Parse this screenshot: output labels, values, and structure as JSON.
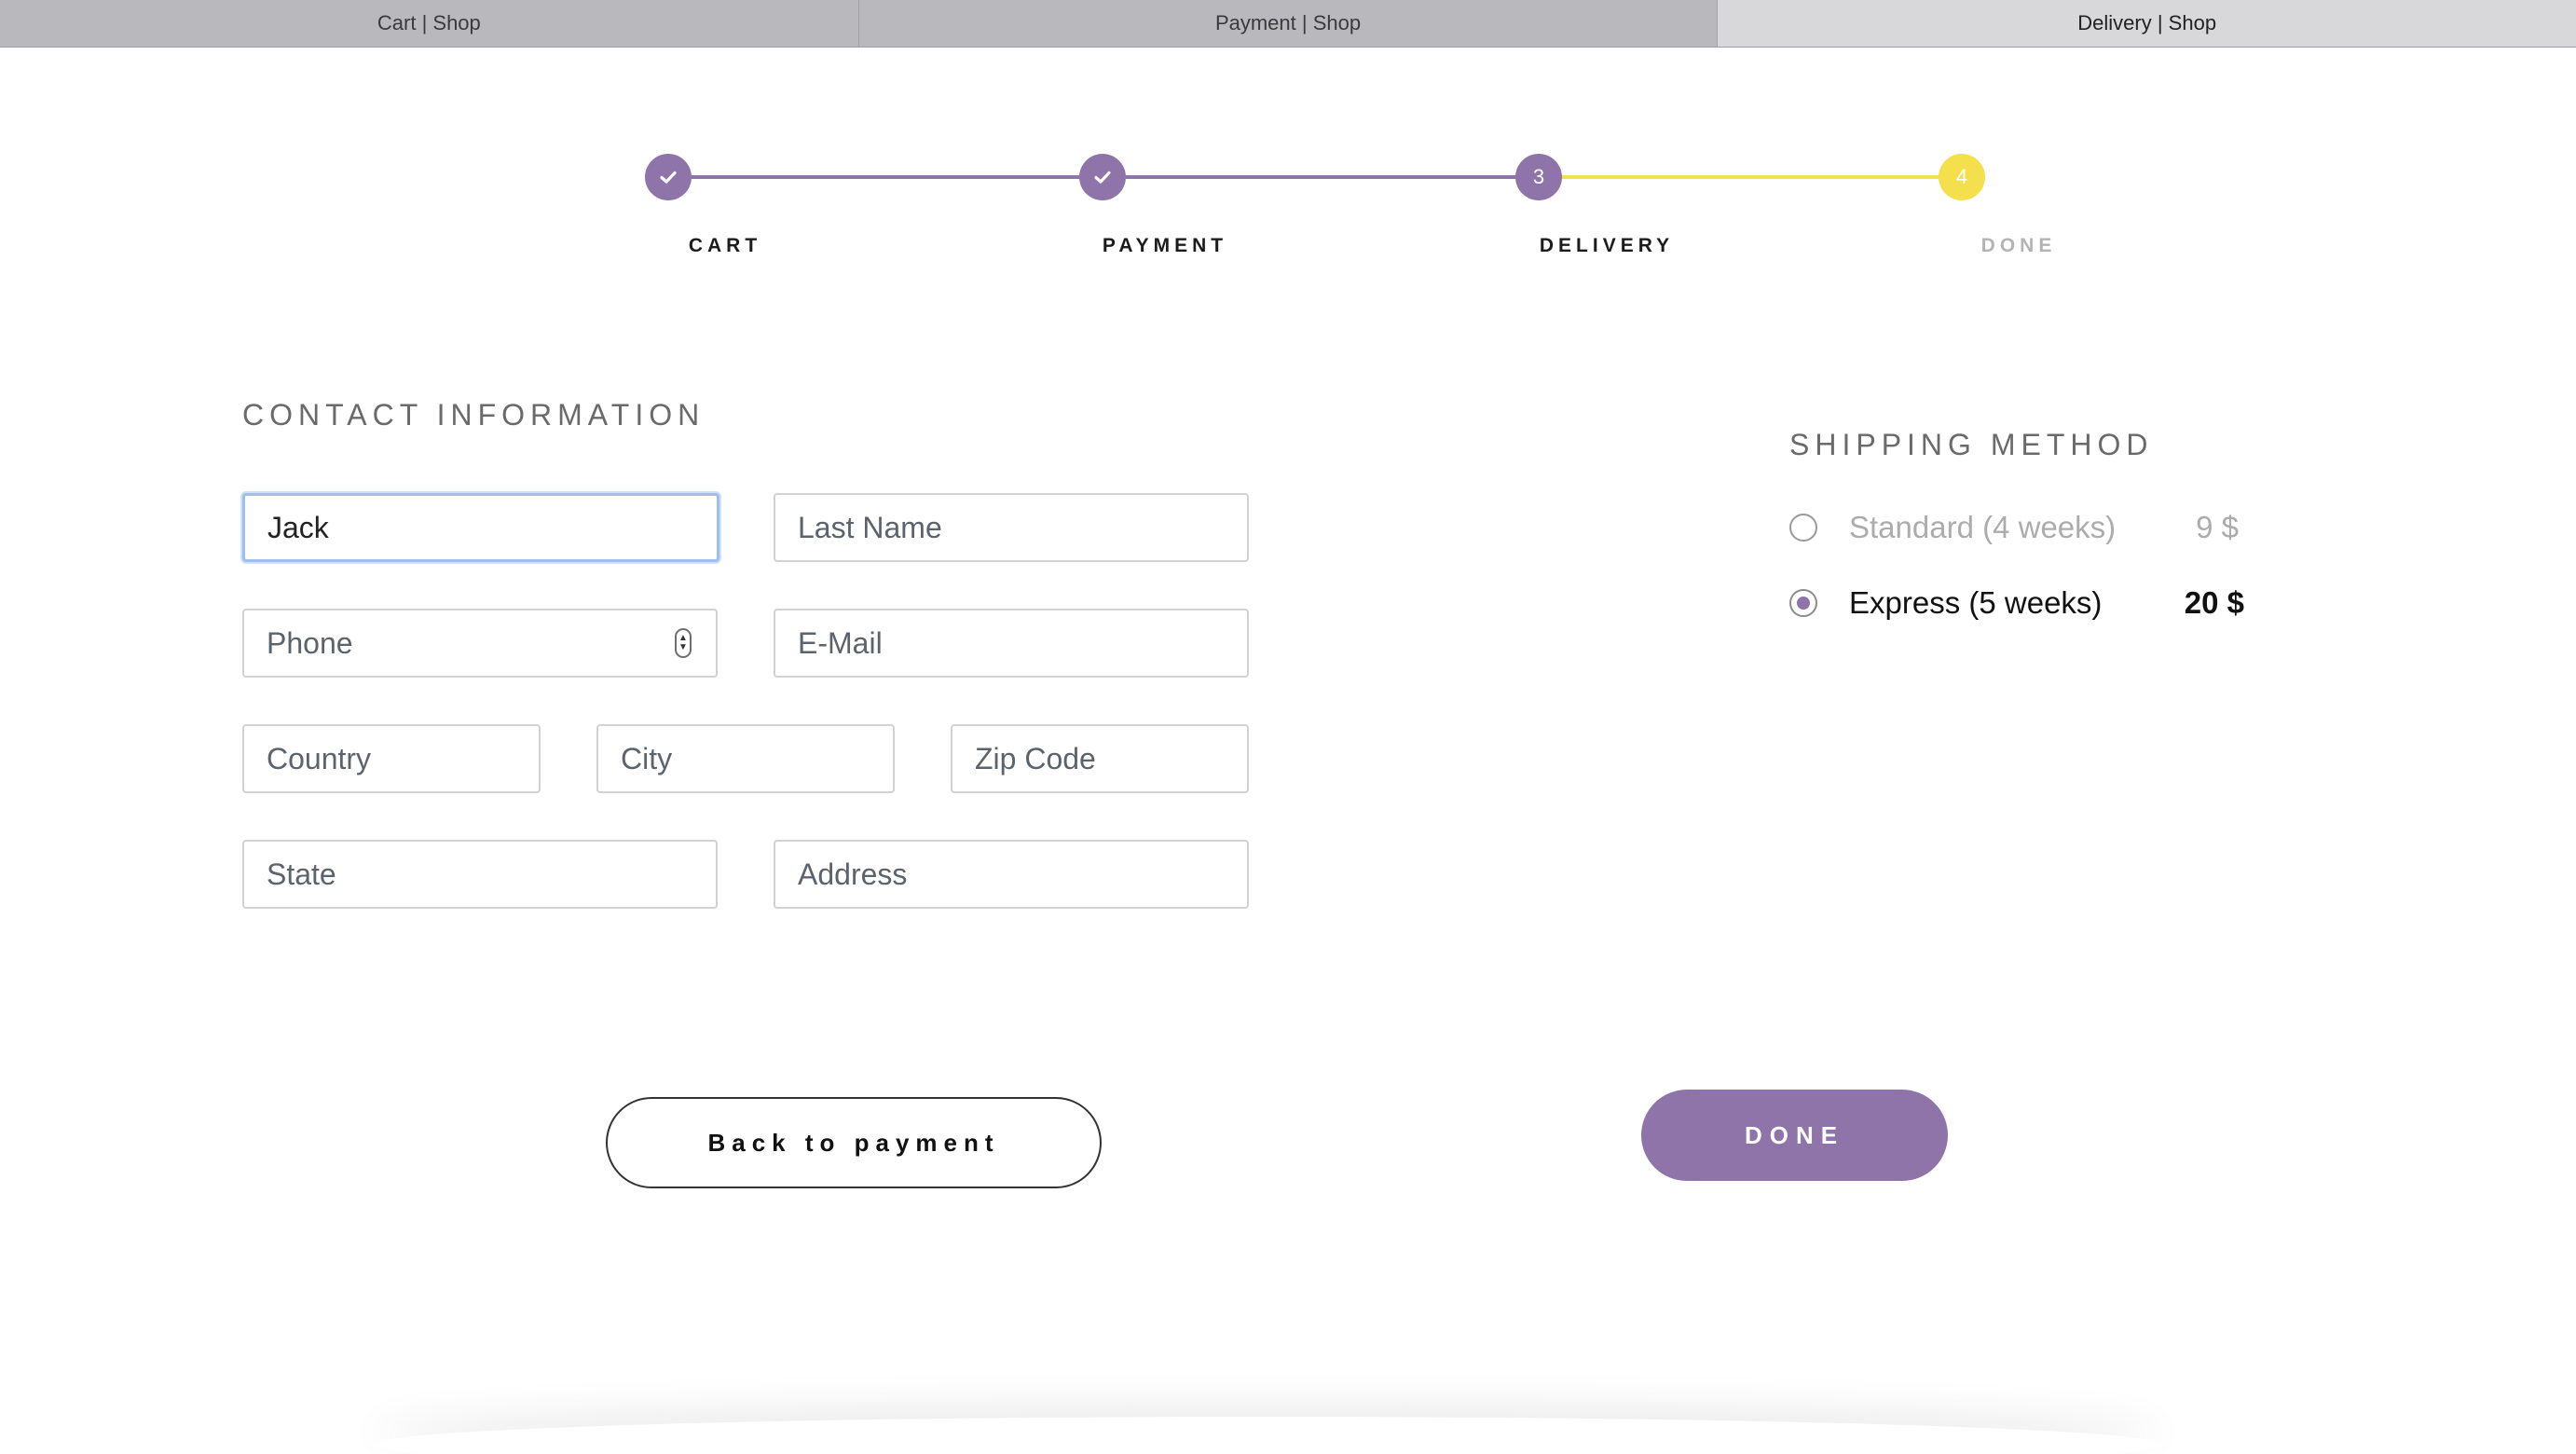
{
  "tabs": [
    {
      "label": "Cart | Shop",
      "active": false
    },
    {
      "label": "Payment | Shop",
      "active": false
    },
    {
      "label": "Delivery | Shop",
      "active": true
    }
  ],
  "stepper": {
    "steps": [
      {
        "label": "CART",
        "state": "complete",
        "icon": "check-icon"
      },
      {
        "label": "PAYMENT",
        "state": "complete",
        "icon": "check-icon"
      },
      {
        "label": "DELIVERY",
        "state": "current",
        "number": "3"
      },
      {
        "label": "DONE",
        "state": "upcoming",
        "number": "4"
      }
    ]
  },
  "contact": {
    "title": "CONTACT INFORMATION",
    "first_name": {
      "value": "Jack",
      "placeholder": ""
    },
    "last_name": {
      "placeholder": "Last Name"
    },
    "phone": {
      "placeholder": "Phone"
    },
    "email": {
      "placeholder": "E-Mail"
    },
    "country": {
      "placeholder": "Country"
    },
    "city": {
      "placeholder": "City"
    },
    "zip": {
      "placeholder": "Zip Code"
    },
    "state": {
      "placeholder": "State"
    },
    "address": {
      "placeholder": "Address"
    }
  },
  "shipping": {
    "title": "SHIPPING METHOD",
    "options": [
      {
        "label": "Standard (4 weeks)",
        "price": "9 $",
        "selected": false
      },
      {
        "label": "Express (5 weeks)",
        "price": "20 $",
        "selected": true
      }
    ]
  },
  "buttons": {
    "back_label": "Back to payment",
    "done_label": "DONE"
  },
  "colors": {
    "accent_purple": "#8e74a8",
    "accent_yellow": "#f4e04d",
    "focus_blue": "#9cbfef"
  }
}
